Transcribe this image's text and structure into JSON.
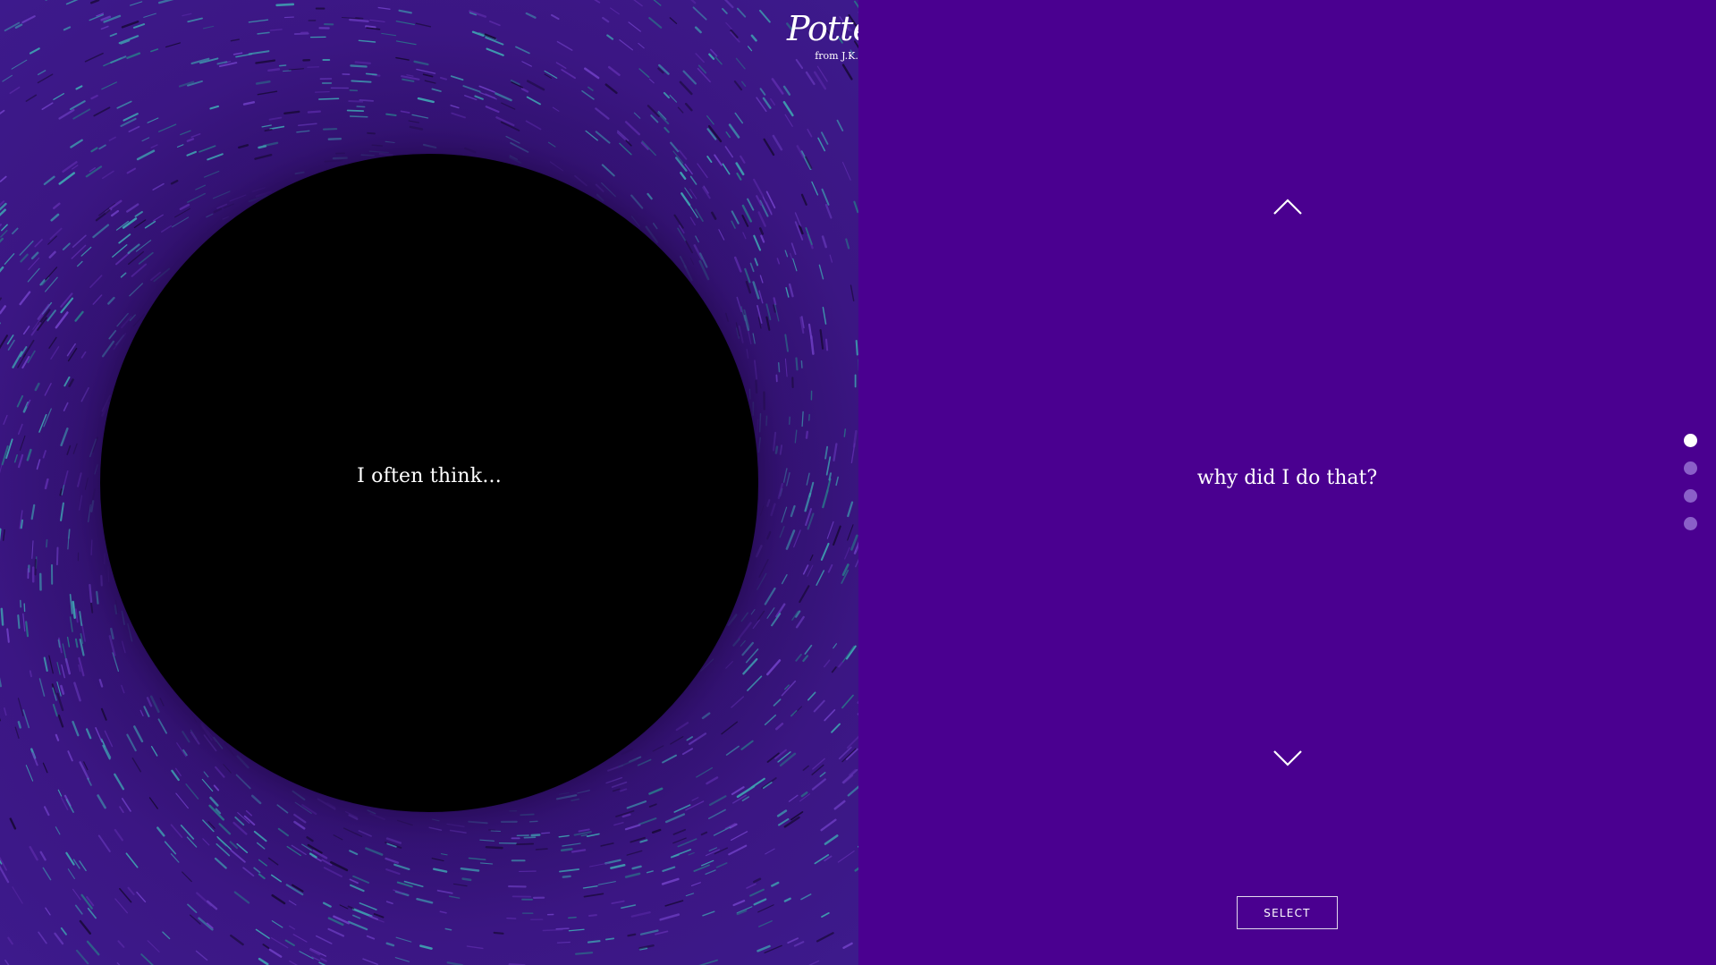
{
  "brand": {
    "logo_text": "Pottermore",
    "subtitle": "from J.K. Rowling"
  },
  "question": {
    "prompt": "I often think..."
  },
  "answer": {
    "current_option": "why did I do that?"
  },
  "controls": {
    "select_label": "SELECT"
  },
  "pager": {
    "total": 4,
    "active_index": 0
  },
  "colors": {
    "panel_purple": "#4a0090",
    "vortex_purple": "#3a1580",
    "vortex_teal": "#3f9db0",
    "pager_inactive": "#8a5fc8",
    "pager_active": "#ffffff"
  },
  "icons": {
    "up": "chevron-up-icon",
    "down": "chevron-down-icon"
  }
}
